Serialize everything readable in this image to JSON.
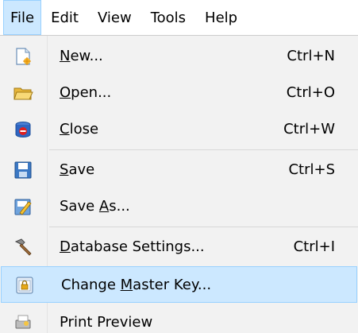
{
  "menubar": {
    "items": [
      {
        "label": "File"
      },
      {
        "label": "Edit"
      },
      {
        "label": "View"
      },
      {
        "label": "Tools"
      },
      {
        "label": "Help"
      }
    ]
  },
  "file_menu": {
    "items": [
      {
        "icon": "new-document-icon",
        "before": "",
        "mnemonic": "N",
        "after": "ew...",
        "shortcut": "Ctrl+N"
      },
      {
        "icon": "open-folder-icon",
        "before": "",
        "mnemonic": "O",
        "after": "pen...",
        "shortcut": "Ctrl+O"
      },
      {
        "icon": "close-database-icon",
        "before": "",
        "mnemonic": "C",
        "after": "lose",
        "shortcut": "Ctrl+W"
      },
      {
        "icon": "save-icon",
        "before": "",
        "mnemonic": "S",
        "after": "ave",
        "shortcut": "Ctrl+S"
      },
      {
        "icon": "save-as-icon",
        "before": "Save ",
        "mnemonic": "A",
        "after": "s...",
        "shortcut": ""
      },
      {
        "icon": "hammer-icon",
        "before": "",
        "mnemonic": "D",
        "after": "atabase Settings...",
        "shortcut": "Ctrl+I"
      },
      {
        "icon": "master-key-icon",
        "before": "Change ",
        "mnemonic": "M",
        "after": "aster Key...",
        "shortcut": ""
      },
      {
        "icon": "print-preview-icon",
        "before": "",
        "mnemonic": "",
        "after": "Print Preview",
        "shortcut": ""
      }
    ],
    "highlighted_item": "Change Master Key..."
  },
  "colors": {
    "menu_background": "#f2f2f2",
    "highlight_background": "#cce8ff",
    "highlight_border": "#99d1ff"
  }
}
